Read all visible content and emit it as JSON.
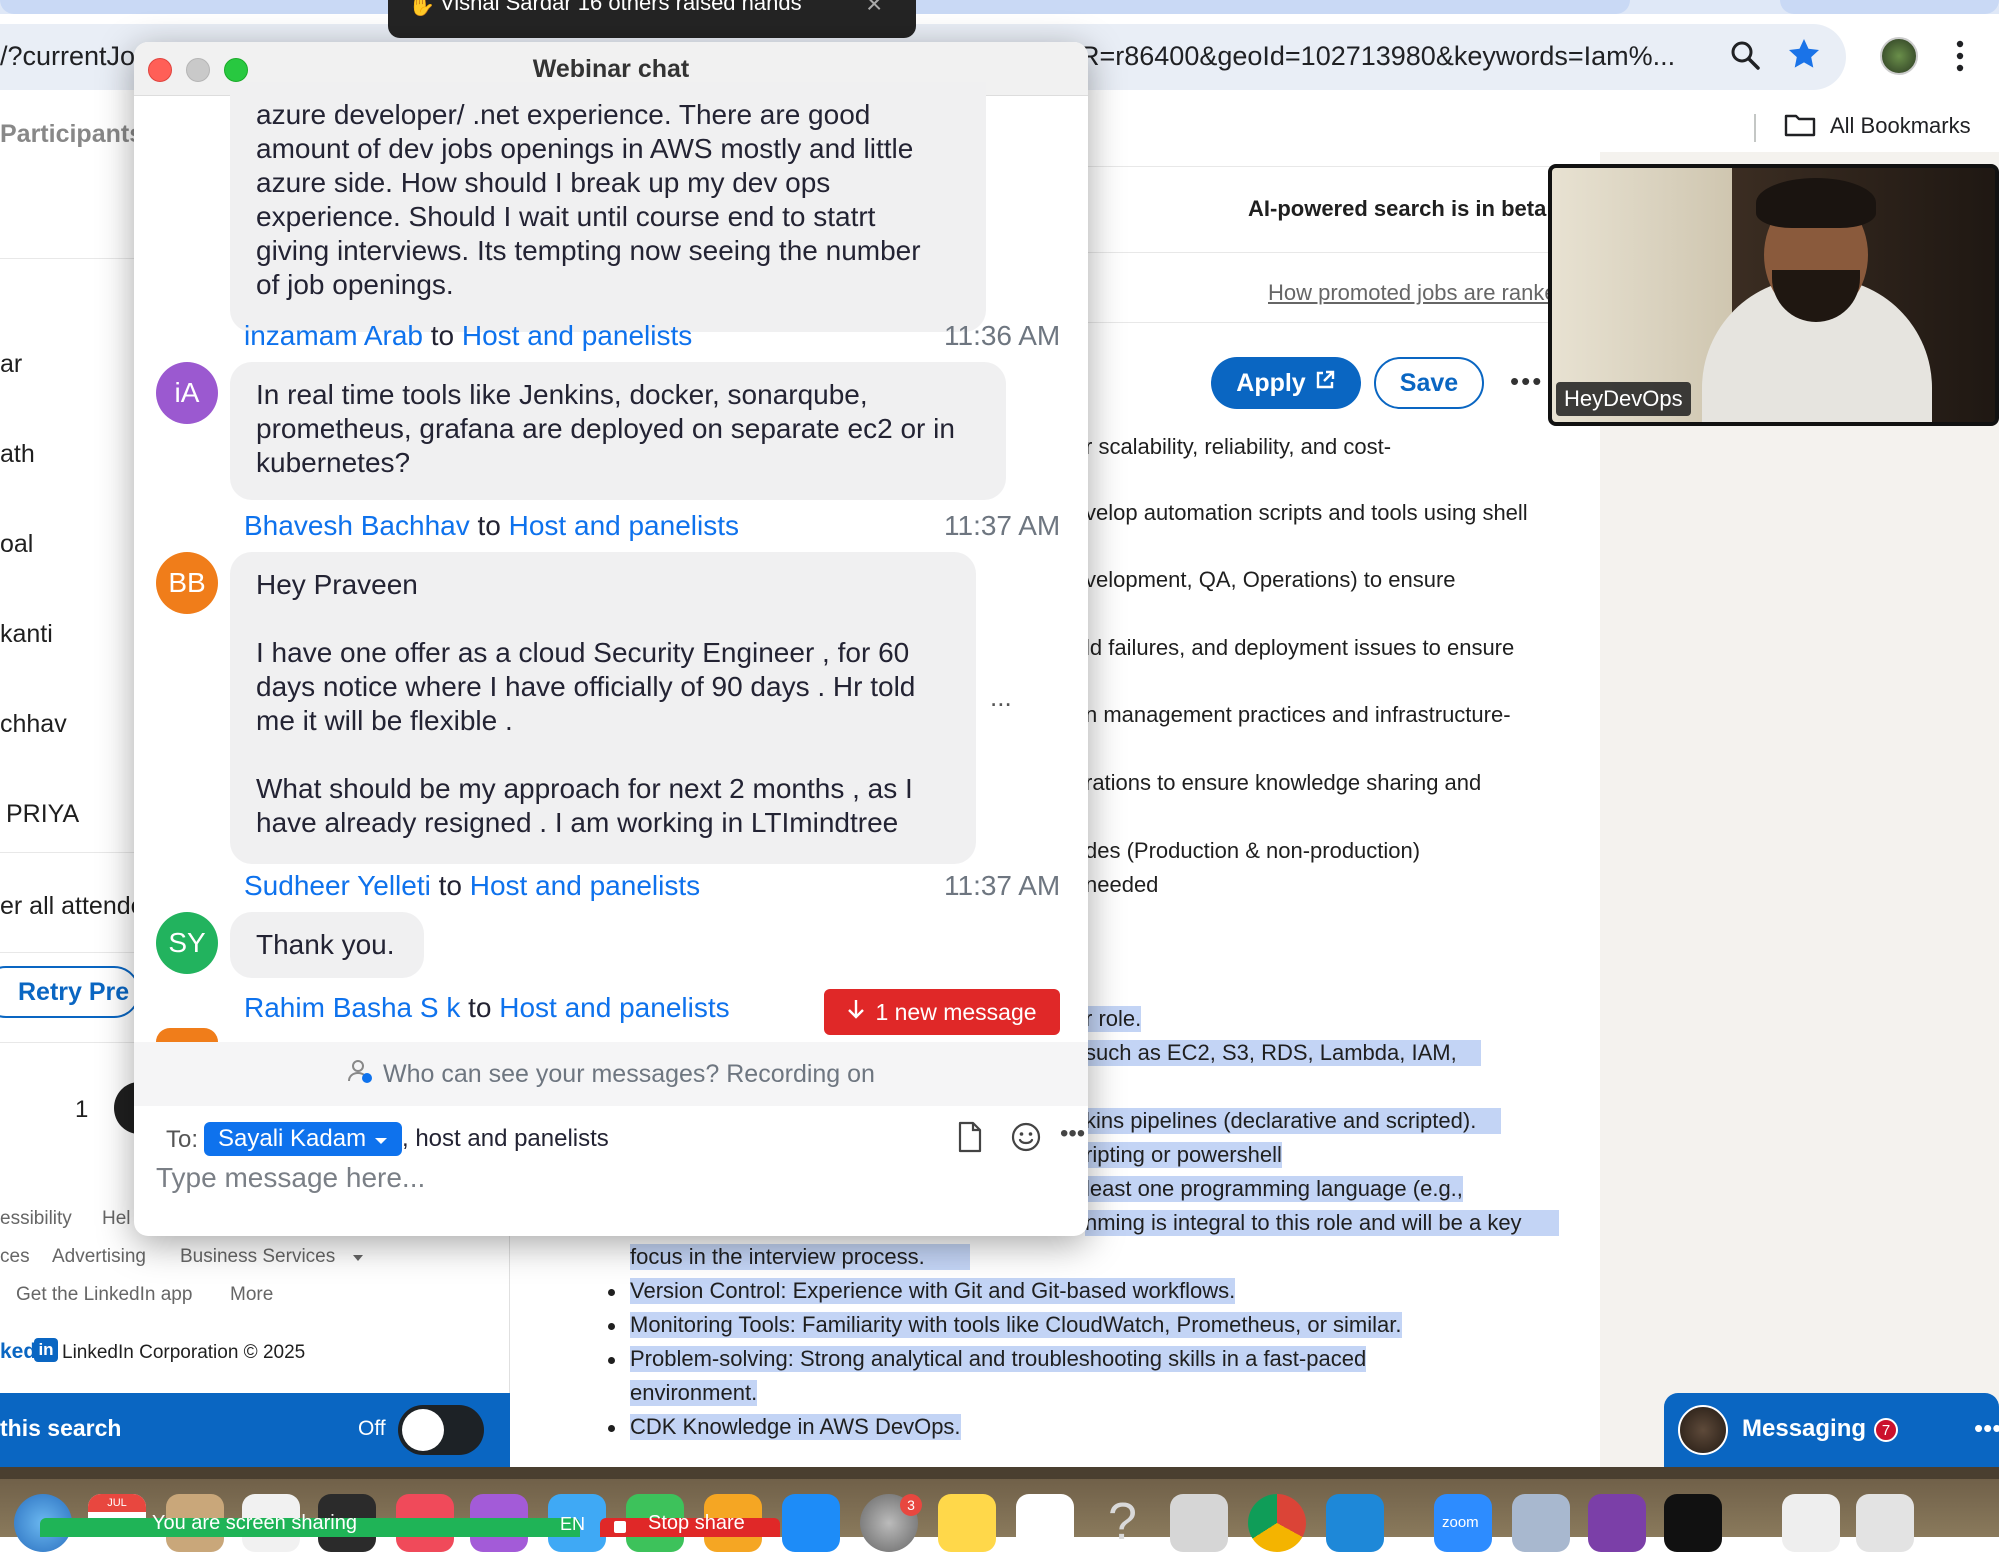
{
  "notification": {
    "text": "Vishal Sardar 16 others raised hands",
    "close": "×"
  },
  "browser": {
    "url_left": "/?currentJo",
    "url_right": "R=r86400&geoId=102713980&keywords=Iam%...",
    "bookmarks_label": "All Bookmarks"
  },
  "linkedin_left": {
    "participants_tab": "Participants",
    "rows": [
      "ar",
      "ath",
      "oal",
      "kanti",
      "chhav",
      "PRIYA"
    ],
    "filter_label": "er all attende",
    "retry_button": "Retry Pre",
    "pagination_page": "1",
    "footer_links": [
      "essibility",
      "Hel",
      "ces",
      "Advertising",
      "Business Services",
      "Get the LinkedIn app",
      "More"
    ],
    "footer_brand": "ked",
    "footer_copyright": "LinkedIn Corporation © 2025",
    "save_search_label": "this search",
    "save_search_state": "Off"
  },
  "linkedin_right": {
    "ai_notice": "AI-powered search is in beta",
    "promoted_link": "How promoted jobs are ranked",
    "apply_label": "Apply",
    "save_label": "Save",
    "more_label": "•••",
    "jd_lines": [
      "r scalability, reliability, and cost-",
      "velop automation scripts and tools using shell",
      "velopment, QA, Operations) to ensure",
      "ld failures, and deployment issues to ensure",
      "n management practices and infrastructure-",
      "rations to ensure knowledge sharing and",
      "des (Production & non-production)",
      "needed"
    ],
    "hl_lines": [
      "r role.",
      "such as EC2, S3, RDS, Lambda, IAM,",
      "kins pipelines (declarative and scripted).",
      "ripting or powershell",
      "least one programming language (e.g.,",
      "nming is integral to this role and will be a key"
    ],
    "bullets": [
      "focus in the interview process.",
      "Version Control: Experience with Git and Git-based workflows.",
      "Monitoring Tools: Familiarity with tools like CloudWatch, Prometheus, or similar.",
      "Problem-solving: Strong analytical and troubleshooting skills in a fast-paced",
      "environment.",
      "CDK Knowledge in AWS DevOps."
    ],
    "messaging_label": "Messaging",
    "messaging_badge": "7"
  },
  "video": {
    "name": "HeyDevOps"
  },
  "chat": {
    "title": "Webinar chat",
    "to_suffix": "to",
    "messages": [
      {
        "text": "azure developer/ .net experience. There are good\namount of dev jobs openings in AWS mostly and little\nazure side. How should I break up my dev ops\nexperience. Should I wait until course end to statrt\ngiving interviews. Its tempting now seeing the number\nof job openings."
      },
      {
        "initials": "iA",
        "color": "#9b59d0",
        "sender": "inzamam Arab",
        "target": "Host and panelists",
        "time": "11:36 AM",
        "text": "In real time tools like Jenkins, docker, sonarqube,\nprometheus, grafana are deployed on separate ec2 or in\nkubernetes?"
      },
      {
        "initials": "BB",
        "color": "#f07d1a",
        "sender": "Bhavesh Bachhav",
        "target": "Host and panelists",
        "time": "11:37 AM",
        "text": "Hey Praveen\n\nI have one offer as a cloud Security Engineer , for 60\ndays notice where I have officially of 90 days . Hr told\nme it will be flexible .\n\nWhat should be my approach for next 2 months , as I\nhave already resigned . I am working in LTImindtree"
      },
      {
        "initials": "SY",
        "color": "#22b35e",
        "sender": "Sudheer Yelleti",
        "target": "Host and panelists",
        "time": "11:37 AM",
        "text": "Thank you."
      },
      {
        "sender": "Rahim Basha S k",
        "target": "Host and panelists"
      }
    ],
    "bubble_more": "...",
    "new_message_label": "1 new message",
    "visibility_text": "Who can see your messages? Recording on",
    "to_label": "To:",
    "recipient": "Sayali Kadam",
    "recipient_extra": ", host and panelists",
    "input_placeholder": "Type message here..."
  },
  "dock": {
    "calendar_month": "JUL",
    "screen_share_text": "You are screen sharing",
    "language": "EN",
    "stop_share": "Stop share",
    "settings_badge": "3",
    "zoom_label": "zoom"
  }
}
